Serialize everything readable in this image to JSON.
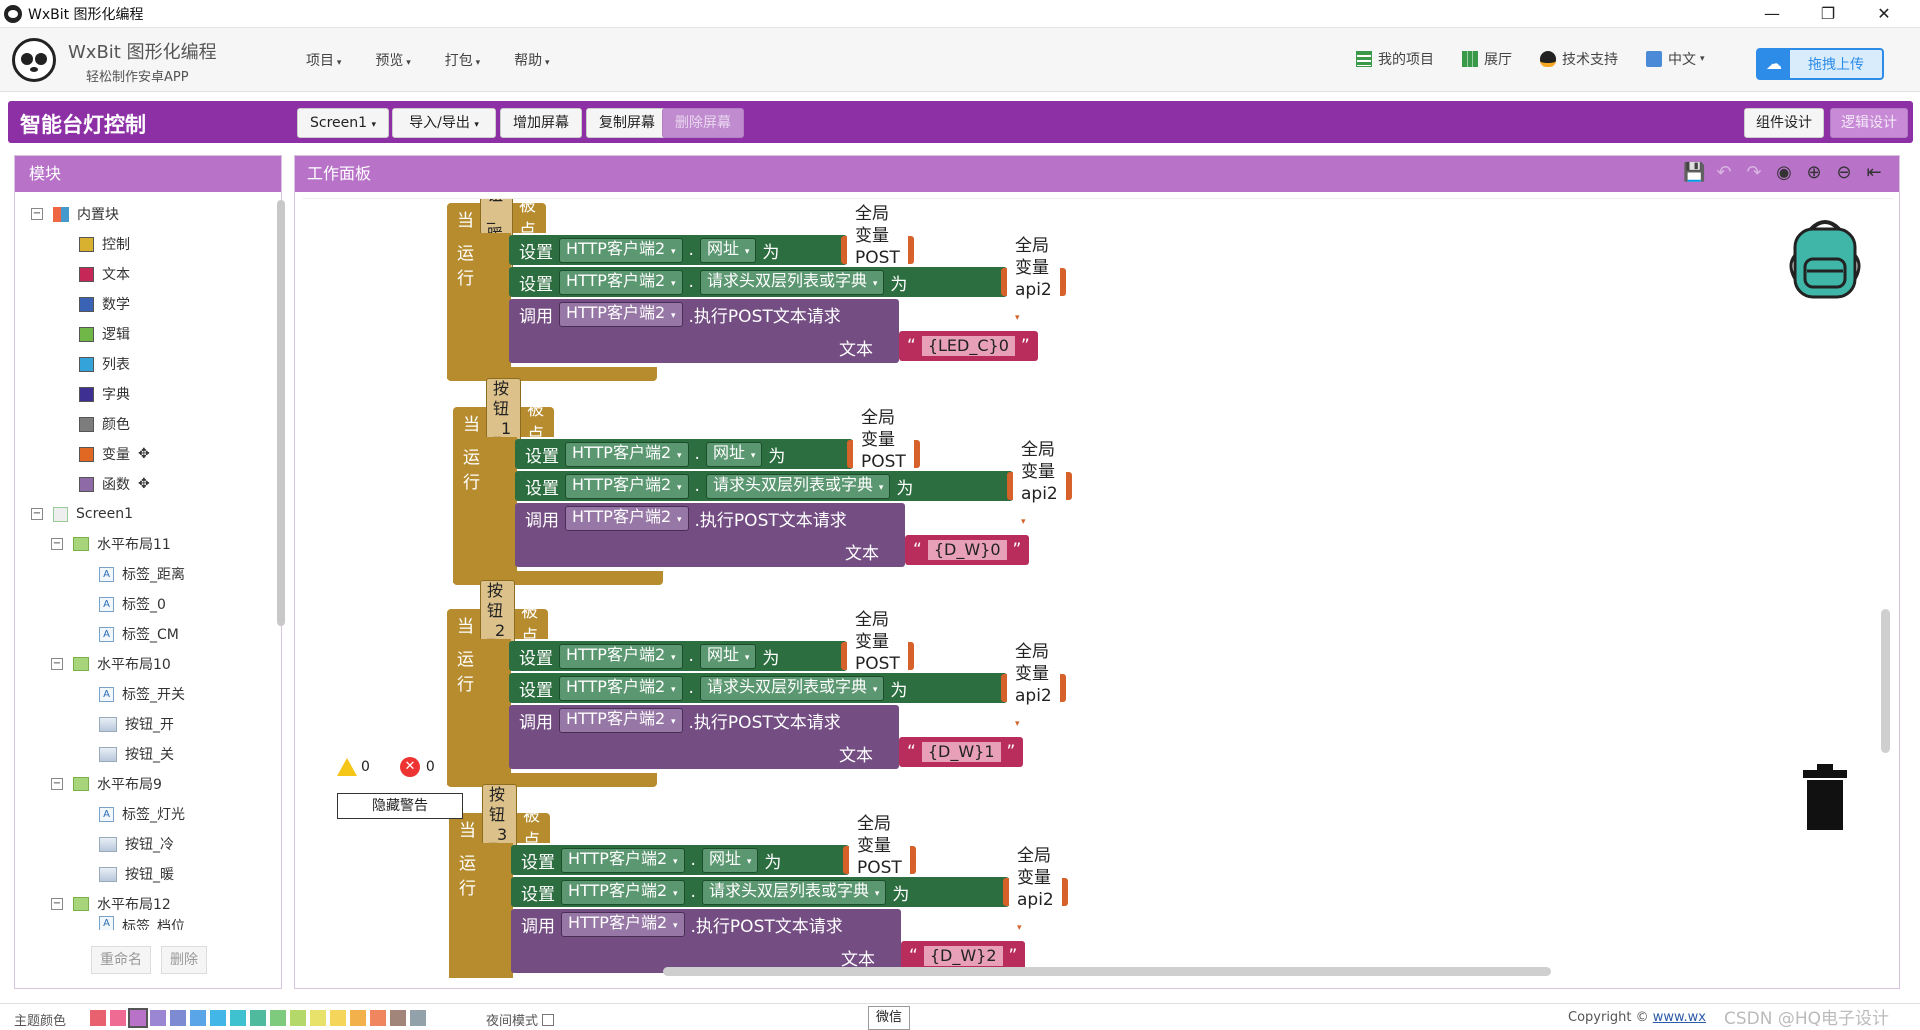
{
  "window": {
    "title": "WxBit 图形化编程"
  },
  "header": {
    "brand_name": "WxBit 图形化编程",
    "brand_tagline": "轻松制作安卓APP",
    "menu": [
      "项目",
      "预览",
      "打包",
      "帮助"
    ],
    "right_menu": [
      {
        "label": "我的项目",
        "icon": "grid-list-icon"
      },
      {
        "label": "展厅",
        "icon": "grid-icon"
      },
      {
        "label": "技术支持",
        "icon": "penguin-icon"
      },
      {
        "label": "中文",
        "icon": "language-icon"
      }
    ],
    "upload_label": "拖拽上传"
  },
  "project": {
    "name": "智能台灯控制",
    "screen_select": "Screen1",
    "import_export": "导入/导出",
    "add_screen": "增加屏幕",
    "copy_screen": "复制屏幕",
    "delete_screen": "删除屏幕",
    "component_design": "组件设计",
    "logic_design": "逻辑设计"
  },
  "modules": {
    "title": "模块",
    "builtin_label": "内置块",
    "builtin": [
      {
        "label": "控制",
        "color": "#d9b130"
      },
      {
        "label": "文本",
        "color": "#c52857"
      },
      {
        "label": "数学",
        "color": "#3a63b5"
      },
      {
        "label": "逻辑",
        "color": "#71b747"
      },
      {
        "label": "列表",
        "color": "#33a3da"
      },
      {
        "label": "字典",
        "color": "#3d3092"
      },
      {
        "label": "颜色",
        "color": "#7d7d7d"
      },
      {
        "label": "变量",
        "color": "#e16822"
      },
      {
        "label": "函数",
        "color": "#8e6aa6"
      }
    ],
    "screen_label": "Screen1",
    "components": [
      {
        "label": "水平布局11",
        "type": "layout",
        "level": 1
      },
      {
        "label": "标签_距离",
        "type": "label",
        "level": 2
      },
      {
        "label": "标签_0",
        "type": "label",
        "level": 2
      },
      {
        "label": "标签_CM",
        "type": "label",
        "level": 2
      },
      {
        "label": "水平布局10",
        "type": "layout",
        "level": 1
      },
      {
        "label": "标签_开关",
        "type": "label",
        "level": 2
      },
      {
        "label": "按钮_开",
        "type": "button",
        "level": 2
      },
      {
        "label": "按钮_关",
        "type": "button",
        "level": 2
      },
      {
        "label": "水平布局9",
        "type": "layout",
        "level": 1
      },
      {
        "label": "标签_灯光",
        "type": "label",
        "level": 2
      },
      {
        "label": "按钮_冷",
        "type": "button",
        "level": 2
      },
      {
        "label": "按钮_暖",
        "type": "button",
        "level": 2
      },
      {
        "label": "水平布局12",
        "type": "layout",
        "level": 1
      },
      {
        "label": "标签_档位",
        "type": "label",
        "level": 2
      }
    ],
    "rename_label": "重命名",
    "delete_label": "删除"
  },
  "workspace": {
    "title": "工作面板",
    "events": [
      {
        "button": "按钮_暖",
        "payload": "{LED_C}0"
      },
      {
        "button": "按钮_1",
        "payload": "{D_W}0"
      },
      {
        "button": "按钮_2",
        "payload": "{D_W}1"
      },
      {
        "button": "按钮_3",
        "payload": "{D_W}2"
      }
    ],
    "block_text": {
      "when": "当",
      "clicked": ".被点击",
      "run": "运行",
      "set": "设置",
      "http_client": "HTTP客户端2",
      "dot": ".",
      "url_prop": "网址",
      "headers_prop": "请求头双层列表或字典",
      "to": "为",
      "global_post": "全局变量 POST",
      "global_api": "全局变量 api2",
      "call": "调用",
      "post_method": ".执行POST文本请求",
      "text_arg": "文本",
      "quote_open": "“",
      "quote_close": "”"
    },
    "warnings_count": "0",
    "errors_count": "0",
    "hide_warnings": "隐藏警告"
  },
  "footer": {
    "theme_label": "主题颜色",
    "theme_colors": [
      "#e8616f",
      "#f06b93",
      "#b873c9",
      "#9b86d4",
      "#7d8bd3",
      "#5aa5e8",
      "#42b6e6",
      "#3fc2cf",
      "#4fba9e",
      "#7fcb7d",
      "#b5d86a",
      "#e8e26a",
      "#f5d65a",
      "#f2b14b",
      "#f08660",
      "#a1857a",
      "#93a2aa"
    ],
    "night_mode": "夜间模式",
    "wechat": "微信",
    "copyright": "Copyright ©",
    "copyright_link": "www.wx",
    "watermark": "CSDN @HQ电子设计"
  }
}
